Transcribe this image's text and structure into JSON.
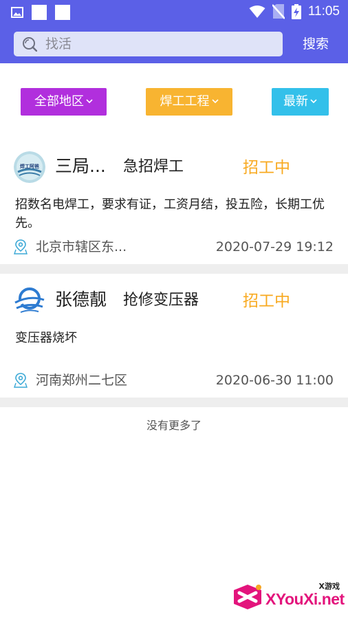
{
  "status_bar": {
    "time": "11:05",
    "icons_left": [
      "gallery-icon",
      "notification-square",
      "notification-square"
    ],
    "icons_right": [
      "wifi-icon",
      "no-sim-icon",
      "battery-charging-icon"
    ]
  },
  "search": {
    "placeholder": "找活",
    "button_label": "搜索"
  },
  "filters": {
    "region": "全部地区",
    "trade": "焊工工程",
    "sort": "最新"
  },
  "jobs": [
    {
      "poster": "三局...",
      "title": "急招焊工",
      "status": "招工中",
      "description": "招数名电焊工，要求有证，工资月结，投五险，长期工优先。",
      "location": "北京市辖区东...",
      "time": "2020-07-29 19:12",
      "avatar_text": "焊工阿爸"
    },
    {
      "poster": "张德靓",
      "title": "抢修变压器",
      "status": "招工中",
      "description": "变压器烧坏",
      "location": "河南郑州二七区",
      "time": "2020-06-30 11:00"
    }
  ],
  "list_end": "没有更多了",
  "watermark": {
    "small": "X游戏",
    "main": "XYouXi.net"
  },
  "colors": {
    "header": "#5b60e7",
    "region_filter": "#b12fdd",
    "trade_filter": "#f8b431",
    "sort_filter": "#33c0ea",
    "status": "#f8a91f"
  }
}
